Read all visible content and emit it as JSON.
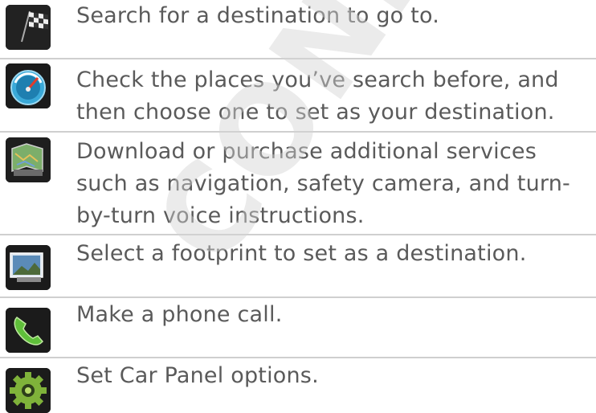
{
  "items": [
    {
      "icon": "checkered-flag-icon",
      "text": "Search for a destination to go to."
    },
    {
      "icon": "speedometer-icon",
      "text": "Check the places you’ve search before, and then choose one to set as your destination."
    },
    {
      "icon": "map-services-icon",
      "text": "Download or purchase additional services such as navigation, safety camera, and turn-by-turn voice instructions."
    },
    {
      "icon": "footprints-photo-icon",
      "text": "Select a footprint to set as a destination."
    },
    {
      "icon": "phone-handset-icon",
      "text": "Make a phone call."
    },
    {
      "icon": "settings-gear-icon",
      "text": "Set Car Panel options."
    }
  ],
  "watermark": "CONFIDENTIAL"
}
